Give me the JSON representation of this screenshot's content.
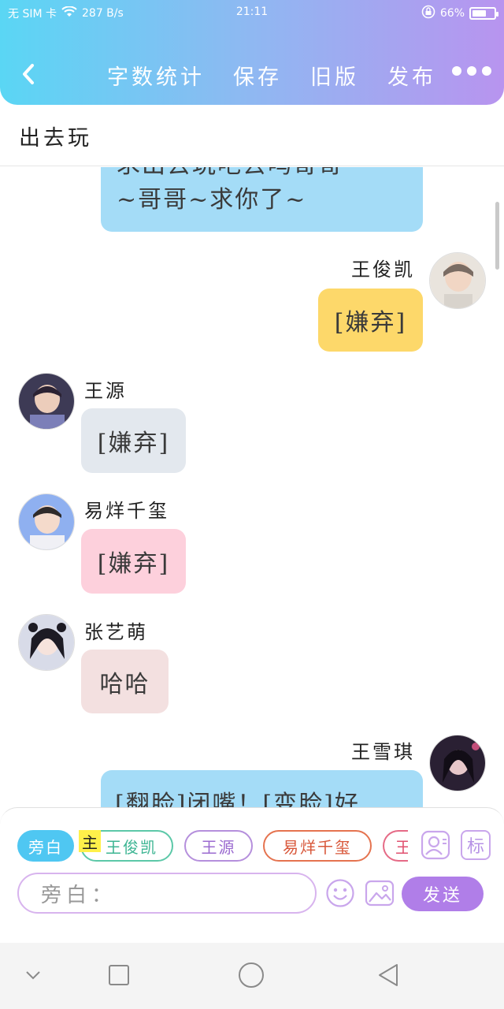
{
  "status_bar": {
    "carrier": "无 SIM 卡",
    "speed": "287 B/s",
    "time": "21:11",
    "battery": "66%",
    "battery_level": 0.66
  },
  "toolbar": {
    "items": [
      "字数统计",
      "保存",
      "旧版",
      "发布"
    ]
  },
  "page_title": "出去玩",
  "messages": [
    {
      "text_line1": "求出去玩吧去吗哥哥",
      "text_line2": "~哥哥~求你了~"
    },
    {
      "name": "王俊凯",
      "text": "[嫌弃]"
    },
    {
      "name": "王源",
      "text": "[嫌弃]"
    },
    {
      "name": "易烊千玺",
      "text": "[嫌弃]"
    },
    {
      "name": "张艺萌",
      "text": "哈哈"
    },
    {
      "name": "王雪琪",
      "text": "[翻脸]闭嘴！[变脸]好"
    }
  ],
  "role_chips": {
    "narration": "旁白",
    "main_marker": "主",
    "roles": [
      "王俊凯",
      "王源",
      "易烊千玺",
      "王"
    ]
  },
  "side_icons": {
    "tag_label": "标"
  },
  "input": {
    "placeholder": "旁白："
  },
  "send_label": "发送",
  "colors": {
    "header_start": "#5ad6f4",
    "header_end": "#b894ef",
    "bubble_blue": "#a4dcf7",
    "bubble_yellow": "#fdd86a",
    "bubble_gray": "#e3e8ee",
    "bubble_pink": "#fdd0dc",
    "bubble_rose": "#f3e0e0",
    "send": "#b07ee8"
  }
}
